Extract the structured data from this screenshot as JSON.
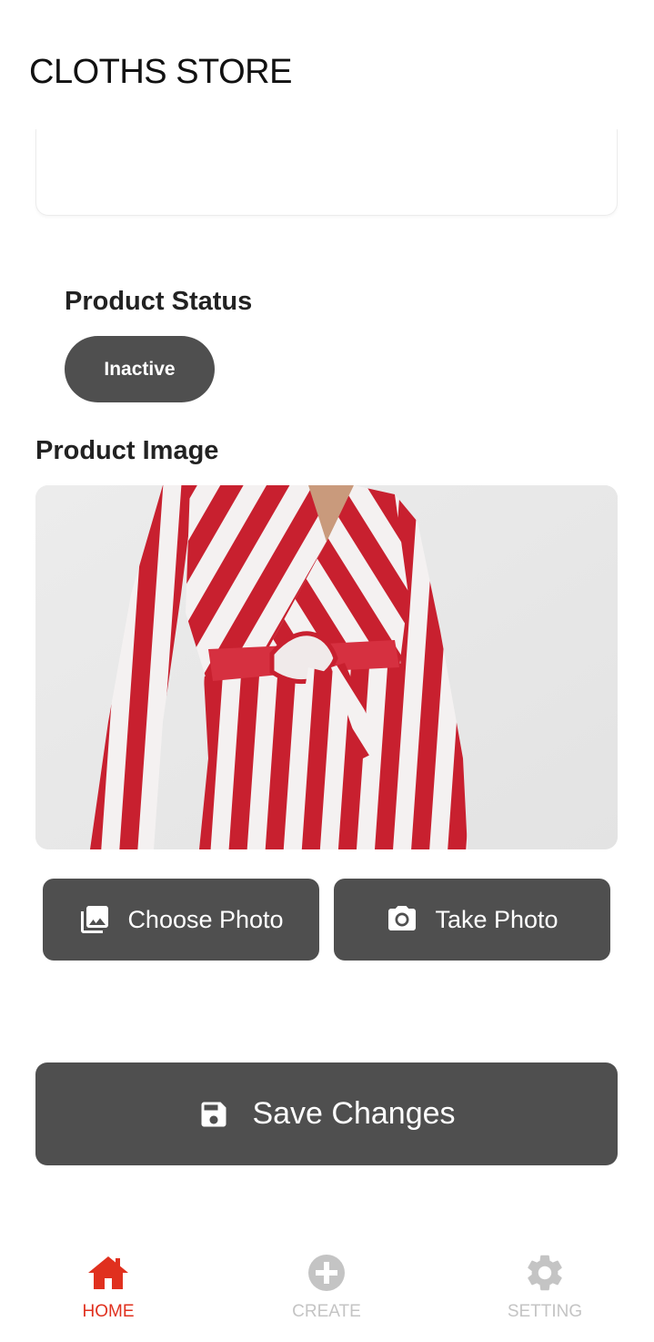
{
  "header": {
    "title": "CLOTHS STORE"
  },
  "status": {
    "label": "Product Status",
    "value": "Inactive"
  },
  "image_section": {
    "label": "Product Image"
  },
  "buttons": {
    "choose_photo": "Choose Photo",
    "take_photo": "Take Photo",
    "save_changes": "Save Changes"
  },
  "icons": {
    "choose_photo": "photo-library-icon",
    "take_photo": "camera-icon",
    "save_changes": "floppy-disk-icon"
  },
  "nav": {
    "items": [
      {
        "label": "HOME",
        "icon": "home-icon",
        "active": true
      },
      {
        "label": "CREATE",
        "icon": "plus-circle-icon",
        "active": false
      },
      {
        "label": "SETTING",
        "icon": "gear-icon",
        "active": false
      }
    ]
  },
  "colors": {
    "accent": "#e0301e",
    "button_bg": "#4f4f4f",
    "nav_inactive": "#c4c4c4",
    "stripe_red": "#c8202f"
  }
}
